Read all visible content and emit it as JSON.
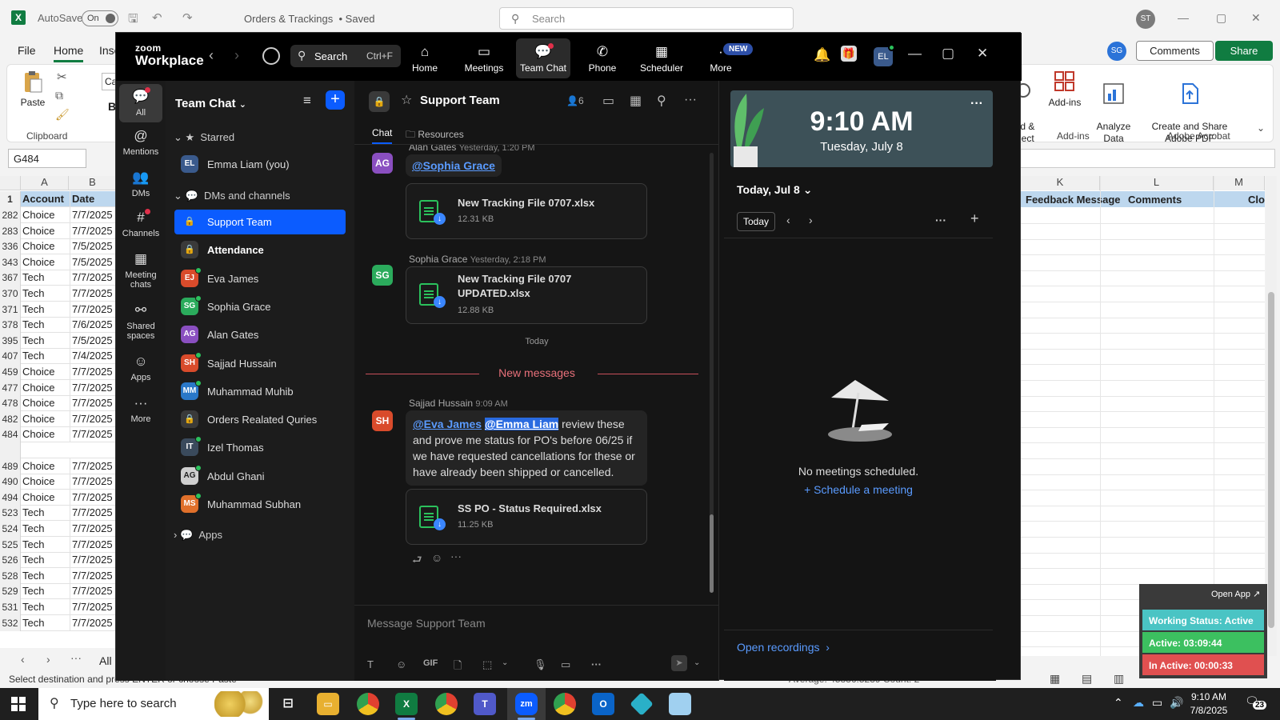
{
  "excel": {
    "logo": "X",
    "autosave_label": "AutoSave",
    "autosave_state": "On",
    "doc_title": "Orders & Trackings",
    "doc_status": "• Saved",
    "search_placeholder": "Search",
    "user_initials": "ST",
    "menu": [
      "File",
      "Home",
      "Inse"
    ],
    "user_sg": "SG",
    "comments_label": "Comments",
    "share_label": "Share",
    "ribbon": {
      "paste": "Paste",
      "clipboard_group": "Clipboard",
      "find_select": "Find &\nSelect",
      "addins": "Add-ins",
      "analyze_data": "Analyze\nData",
      "create_share_pdf": "Create and Share\nAdobe PDF",
      "addins_group": "Add-ins",
      "acrobat_group": "Adobe Acrobat",
      "b_label": "B",
      "font_box": "Ca"
    },
    "name_box": "G484",
    "columns": [
      "A",
      "B"
    ],
    "right_columns": [
      "K",
      "L",
      "M"
    ],
    "header_row": {
      "num": "1",
      "a": "Account",
      "b": "Date"
    },
    "right_headers": [
      "Feedback Message",
      "Comments",
      "Clo"
    ],
    "rows": [
      {
        "num": "282",
        "a": "Choice",
        "b": "7/7/2025"
      },
      {
        "num": "283",
        "a": "Choice",
        "b": "7/7/2025"
      },
      {
        "num": "336",
        "a": "Choice",
        "b": "7/5/2025"
      },
      {
        "num": "343",
        "a": "Choice",
        "b": "7/5/2025"
      },
      {
        "num": "367",
        "a": "Tech",
        "b": "7/7/2025"
      },
      {
        "num": "370",
        "a": "Tech",
        "b": "7/7/2025"
      },
      {
        "num": "371",
        "a": "Tech",
        "b": "7/7/2025"
      },
      {
        "num": "378",
        "a": "Tech",
        "b": "7/6/2025"
      },
      {
        "num": "395",
        "a": "Tech",
        "b": "7/5/2025"
      },
      {
        "num": "407",
        "a": "Tech",
        "b": "7/4/2025"
      },
      {
        "num": "459",
        "a": "Choice",
        "b": "7/7/2025"
      },
      {
        "num": "477",
        "a": "Choice",
        "b": "7/7/2025"
      },
      {
        "num": "478",
        "a": "Choice",
        "b": "7/7/2025"
      },
      {
        "num": "482",
        "a": "Choice",
        "b": "7/7/2025"
      },
      {
        "num": "484",
        "a": "Choice",
        "b": "7/7/2025"
      },
      {
        "num": "",
        "a": "",
        "b": ""
      },
      {
        "num": "489",
        "a": "Choice",
        "b": "7/7/2025"
      },
      {
        "num": "490",
        "a": "Choice",
        "b": "7/7/2025"
      },
      {
        "num": "494",
        "a": "Choice",
        "b": "7/7/2025"
      },
      {
        "num": "523",
        "a": "Tech",
        "b": "7/7/2025"
      },
      {
        "num": "524",
        "a": "Tech",
        "b": "7/7/2025"
      },
      {
        "num": "525",
        "a": "Tech",
        "b": "7/7/2025"
      },
      {
        "num": "526",
        "a": "Tech",
        "b": "7/7/2025"
      },
      {
        "num": "528",
        "a": "Tech",
        "b": "7/7/2025"
      },
      {
        "num": "529",
        "a": "Tech",
        "b": "7/7/2025"
      },
      {
        "num": "531",
        "a": "Tech",
        "b": "7/7/2025"
      },
      {
        "num": "532",
        "a": "Tech",
        "b": "7/7/2025"
      }
    ],
    "sheet_all": "All",
    "status_text": "Select destination and press ENTER or choose Paste",
    "status_avg": "Average: 45836.5239   Count: 2"
  },
  "zoom": {
    "brand_small": "zoom",
    "brand_big": "Workplace",
    "search_label": "Search",
    "search_shortcut": "Ctrl+F",
    "tabs": [
      {
        "label": "Home",
        "icon": "home-icon"
      },
      {
        "label": "Meetings",
        "icon": "video-icon"
      },
      {
        "label": "Team Chat",
        "icon": "chat-icon"
      },
      {
        "label": "Phone",
        "icon": "phone-icon"
      },
      {
        "label": "Scheduler",
        "icon": "calendar-icon"
      },
      {
        "label": "More",
        "icon": "more-icon"
      }
    ],
    "new_badge": "NEW",
    "user_initials": "EL",
    "rail": [
      {
        "label": "All",
        "icon": "chat-bubble-icon"
      },
      {
        "label": "Mentions",
        "icon": "at-icon"
      },
      {
        "label": "DMs",
        "icon": "people-icon"
      },
      {
        "label": "Channels",
        "icon": "hash-icon"
      },
      {
        "label": "Meeting chats",
        "icon": "calendar-icon"
      },
      {
        "label": "Shared spaces",
        "icon": "share-icon"
      },
      {
        "label": "Apps",
        "icon": "apps-icon"
      },
      {
        "label": "More",
        "icon": "more-icon"
      }
    ],
    "sidebar": {
      "title": "Team Chat",
      "starred_label": "Starred",
      "dms_label": "DMs and channels",
      "apps_label": "Apps",
      "starred": [
        {
          "initials": "EL",
          "name": "Emma Liam (you)",
          "color": "#3a5a8c"
        }
      ],
      "items": [
        {
          "type": "channel",
          "name": "Support Team",
          "selected": true,
          "bold": false
        },
        {
          "type": "channel",
          "name": "Attendance",
          "selected": false,
          "bold": true
        },
        {
          "type": "user",
          "initials": "EJ",
          "name": "Eva James",
          "color": "#d94b2b",
          "online": true
        },
        {
          "type": "user",
          "initials": "SG",
          "name": "Sophia Grace",
          "color": "#2bab5c",
          "online": true
        },
        {
          "type": "user",
          "initials": "AG",
          "name": "Alan Gates",
          "color": "#8a4fc0",
          "online": false
        },
        {
          "type": "user",
          "initials": "SH",
          "name": "Sajjad Hussain",
          "color": "#d94b2b",
          "online": true
        },
        {
          "type": "user",
          "initials": "MM",
          "name": "Muhammad Muhib",
          "color": "#2a78c8",
          "online": true
        },
        {
          "type": "channel",
          "name": "Orders Realated Quries",
          "selected": false,
          "bold": false
        },
        {
          "type": "user",
          "initials": "IT",
          "name": "Izel Thomas",
          "color": "#3a4a5c",
          "online": true
        },
        {
          "type": "user",
          "initials": "AG",
          "name": "Abdul Ghani",
          "color": "#cfcfcf",
          "online": true
        },
        {
          "type": "user",
          "initials": "MS",
          "name": "Muhammad Subhan",
          "color": "#e0702b",
          "online": true
        }
      ]
    },
    "chat": {
      "title": "Support Team",
      "member_count": "6",
      "tab_chat": "Chat",
      "tab_resources": "Resources",
      "msg1": {
        "initials": "AG",
        "author": "Alan Gates",
        "time": "Yesterday, 1:20 PM",
        "mention": "@Sophia Grace",
        "file_name": "New Tracking File 0707.xlsx",
        "file_size": "12.31 KB"
      },
      "msg2": {
        "initials": "SG",
        "author": "Sophia Grace",
        "time": "Yesterday, 2:18 PM",
        "file_name": "New Tracking File 0707 UPDATED.xlsx",
        "file_size": "12.88 KB"
      },
      "today_label": "Today",
      "new_messages": "New messages",
      "msg3": {
        "initials": "SH",
        "author": "Sajjad Hussain",
        "time": "9:09 AM",
        "mention1": "@Eva James",
        "mention2": "@Emma Liam",
        "text": " review these and prove me status for PO's before 06/25 if we have requested cancellations for these or have already been shipped or cancelled.",
        "file_name": "SS PO - Status Required.xlsx",
        "file_size": "11.25 KB"
      },
      "placeholder": "Message Support Team",
      "gif": "GIF"
    },
    "calendar": {
      "time": "9:10 AM",
      "date": "Tuesday, July 8",
      "day_select": "Today, Jul 8",
      "today_button": "Today",
      "empty": "No meetings scheduled.",
      "schedule": "Schedule a meeting",
      "recordings": "Open recordings"
    }
  },
  "widget": {
    "open_app": "Open App ↗",
    "status": "Working Status: Active",
    "active": "Active: 03:09:44",
    "inactive": "In Active: 00:00:33"
  },
  "taskbar": {
    "search": "Type here to search",
    "time": "9:10 AM",
    "date": "7/8/2025",
    "notifications": "23"
  }
}
